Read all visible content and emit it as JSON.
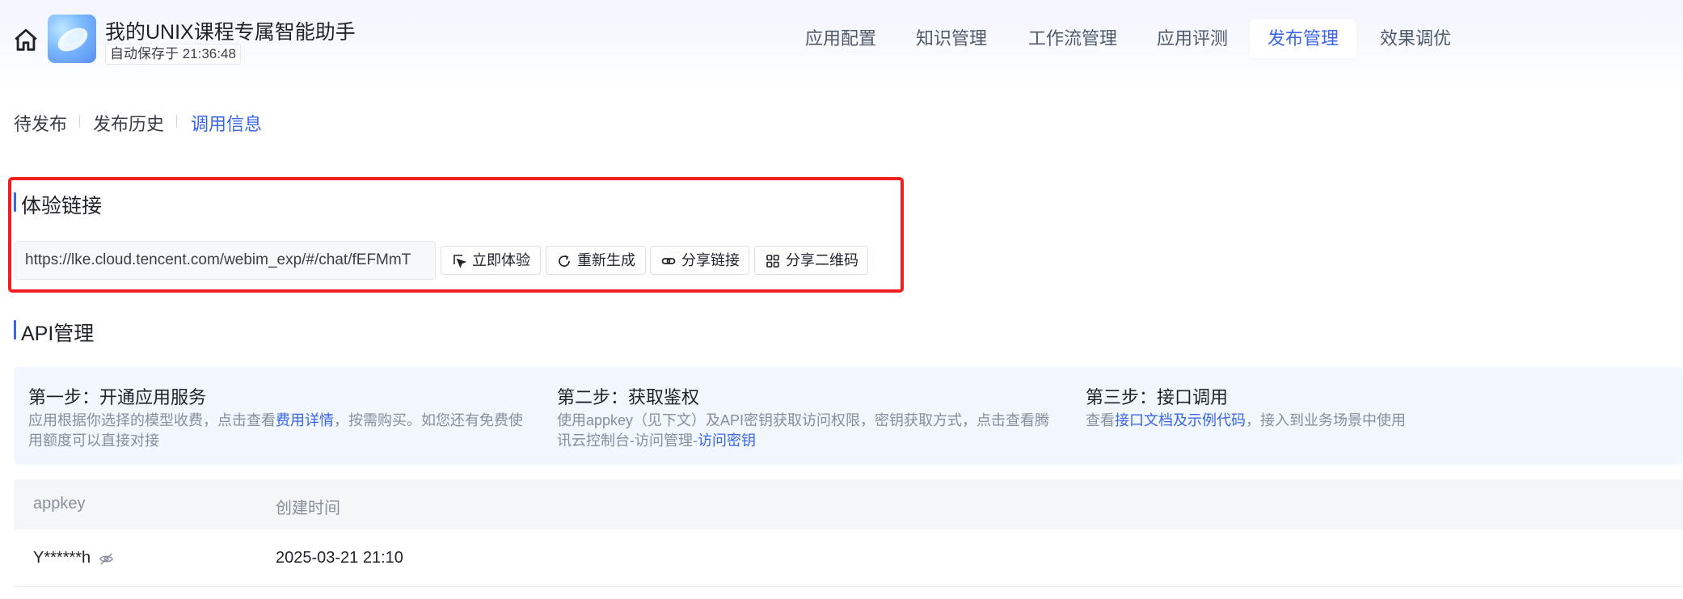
{
  "header": {
    "app_title": "我的UNIX课程专属智能助手",
    "autosave": "自动保存于 21:36:48",
    "nav": [
      "应用配置",
      "知识管理",
      "工作流管理",
      "应用评测",
      "发布管理",
      "效果调优"
    ],
    "active_nav": "发布管理"
  },
  "subtabs": {
    "items": [
      "待发布",
      "发布历史",
      "调用信息"
    ],
    "active": "调用信息"
  },
  "experience": {
    "title": "体验链接",
    "url": "https://lke.cloud.tencent.com/webim_exp/#/chat/fEFMmT",
    "buttons": {
      "try": "立即体验",
      "regenerate": "重新生成",
      "share_link": "分享链接",
      "share_qr": "分享二维码"
    }
  },
  "api": {
    "title": "API管理",
    "steps": [
      {
        "title": "第一步：开通应用服务",
        "desc_pre": "应用根据你选择的模型收费，点击查看",
        "link": "费用详情",
        "desc_post": "，按需购买。如您还有免费使用额度可以直接对接"
      },
      {
        "title": "第二步：获取鉴权",
        "desc_pre": "使用appkey（见下文）及API密钥获取访问权限，密钥获取方式，点击查看腾讯云控制台-访问管理-",
        "link": "访问密钥",
        "desc_post": ""
      },
      {
        "title": "第三步：接口调用",
        "desc_pre": "查看",
        "link": "接口文档及示例代码",
        "desc_post": "，接入到业务场景中使用"
      }
    ],
    "table": {
      "columns": [
        "appkey",
        "创建时间"
      ],
      "rows": [
        {
          "appkey": "Y******h",
          "created": "2025-03-21 21:10"
        }
      ]
    }
  },
  "colors": {
    "accent": "#3a66e8",
    "highlight": "#f02020",
    "panel_bg": "#f2f6fd"
  }
}
